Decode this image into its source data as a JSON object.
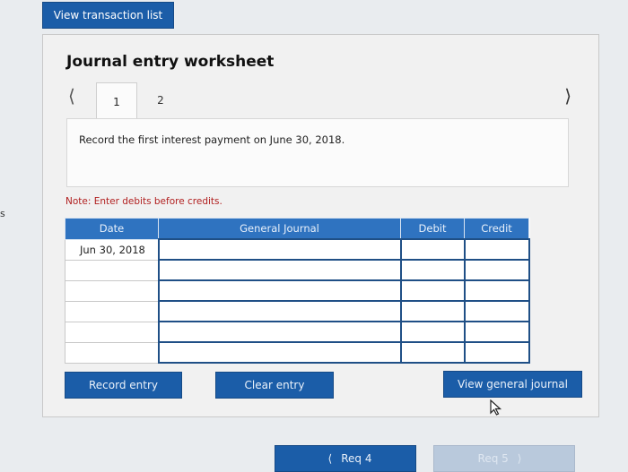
{
  "header": {
    "view_transaction_list": "View transaction list"
  },
  "side_marker": "s",
  "worksheet": {
    "title": "Journal entry worksheet",
    "tabs": [
      {
        "label": "1",
        "active": true
      },
      {
        "label": "2",
        "active": false
      }
    ],
    "nav_prev_icon": "chevron-left-icon",
    "nav_next_icon": "chevron-right-icon",
    "instruction": "Record the first interest payment on June 30, 2018.",
    "note": "Note: Enter debits before credits."
  },
  "table": {
    "columns": [
      "Date",
      "General Journal",
      "Debit",
      "Credit"
    ],
    "rows": [
      {
        "date": "Jun 30, 2018",
        "general_journal": "",
        "debit": "",
        "credit": ""
      },
      {
        "date": "",
        "general_journal": "",
        "debit": "",
        "credit": ""
      },
      {
        "date": "",
        "general_journal": "",
        "debit": "",
        "credit": ""
      },
      {
        "date": "",
        "general_journal": "",
        "debit": "",
        "credit": ""
      },
      {
        "date": "",
        "general_journal": "",
        "debit": "",
        "credit": ""
      },
      {
        "date": "",
        "general_journal": "",
        "debit": "",
        "credit": ""
      }
    ]
  },
  "actions": {
    "record_entry": "Record entry",
    "clear_entry": "Clear entry",
    "view_general_journal": "View general journal"
  },
  "footer": {
    "prev_label": "Req 4",
    "next_label": "Req 5"
  },
  "colors": {
    "button_blue": "#1b5da8",
    "header_blue": "#2f73c0",
    "note_red": "#b11f1f",
    "disabled_blue": "#b9c9dc"
  }
}
